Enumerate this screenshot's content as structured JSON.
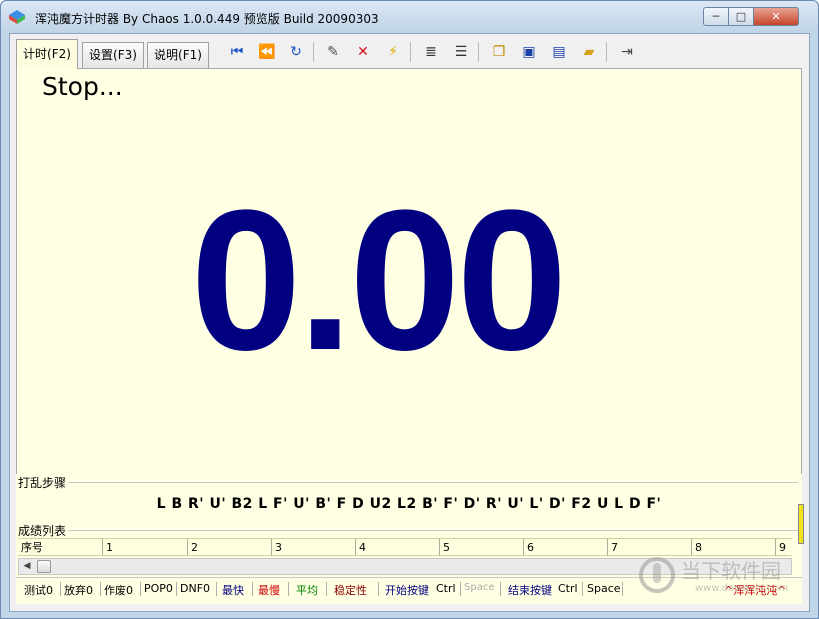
{
  "window": {
    "title": "浑沌魔方计时器 By Chaos 1.0.0.449 预览版 Build 20090303",
    "min_label": "─",
    "max_label": "□",
    "close_label": "✕"
  },
  "tabs": [
    {
      "label": "计时(F2)",
      "active": true
    },
    {
      "label": "设置(F3)",
      "active": false
    },
    {
      "label": "说明(F1)",
      "active": false
    }
  ],
  "toolbar": {
    "icons": [
      "first-icon",
      "rewind-icon",
      "redo-icon",
      "edit-icon",
      "delete-icon",
      "lightning-icon",
      "align-center-icon",
      "align-justify-icon",
      "copy-icon",
      "save-icon",
      "save-as-icon",
      "open-folder-icon",
      "exit-icon"
    ]
  },
  "timer": {
    "status": "Stop...",
    "time": "0.00",
    "color": "#000080"
  },
  "scramble": {
    "label": "打乱步骤",
    "text": "L B R' U' B2 L F' U' B' F D U2 L2 B' F' D' R' U' L' D' F2 U L D F'"
  },
  "results": {
    "label": "成绩列表",
    "headers": [
      "序号",
      "1",
      "2",
      "3",
      "4",
      "5",
      "6",
      "7",
      "8",
      "9"
    ]
  },
  "status": {
    "tests": "测试0",
    "abandon": "放弃0",
    "void": "作废0",
    "pop": "POP0",
    "dnf": "DNF0",
    "fastest": "最快",
    "slowest": "最慢",
    "average": "平均",
    "stability": "稳定性",
    "start_key_label": "开始按键",
    "start_key_ctrl": "Ctrl",
    "start_key_space": "Space",
    "end_key_label": "结束按键",
    "end_key_ctrl": "Ctrl",
    "end_key_space": "Space",
    "app_link": "^浑浑沌沌^"
  },
  "colors": {
    "accent_red": "#cc0000",
    "accent_green": "#008000",
    "accent_blue": "#000080"
  },
  "watermark": {
    "text": "当下软件园",
    "url": "www.downxia.com"
  }
}
